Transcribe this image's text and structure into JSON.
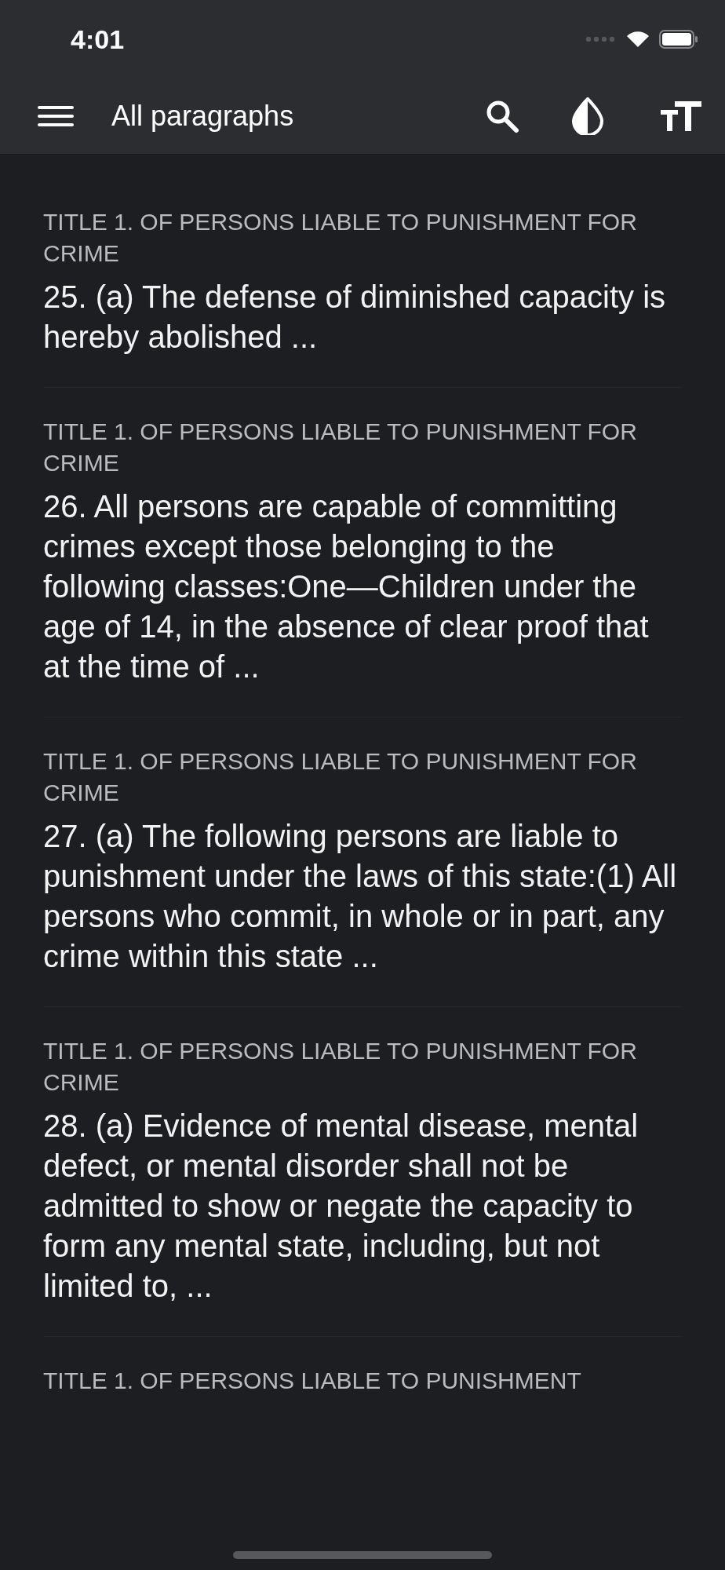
{
  "status_bar": {
    "time": "4:01"
  },
  "nav_bar": {
    "title": "All paragraphs"
  },
  "paragraphs": [
    {
      "title": "TITLE 1. OF PERSONS LIABLE TO PUNISHMENT FOR CRIME",
      "text": "25. (a) The defense of diminished capacity is hereby abolished ..."
    },
    {
      "title": "TITLE 1. OF PERSONS LIABLE TO PUNISHMENT FOR CRIME",
      "text": "26. All persons are capable of committing crimes except those belonging to the following classes:One—Children under the age of 14, in the absence of clear proof that at the time of ..."
    },
    {
      "title": "TITLE 1. OF PERSONS LIABLE TO PUNISHMENT FOR CRIME",
      "text": "27. (a) The following persons are liable to punishment under the laws of this state:(1) All persons who commit, in whole or in part, any crime within this state ..."
    },
    {
      "title": "TITLE 1. OF PERSONS LIABLE TO PUNISHMENT FOR CRIME",
      "text": "28. (a) Evidence of mental disease, mental defect, or mental disorder shall not be admitted to show or negate the capacity to form any mental state, including, but not limited to, ..."
    },
    {
      "title": "TITLE 1. OF PERSONS LIABLE TO PUNISHMENT"
    }
  ]
}
